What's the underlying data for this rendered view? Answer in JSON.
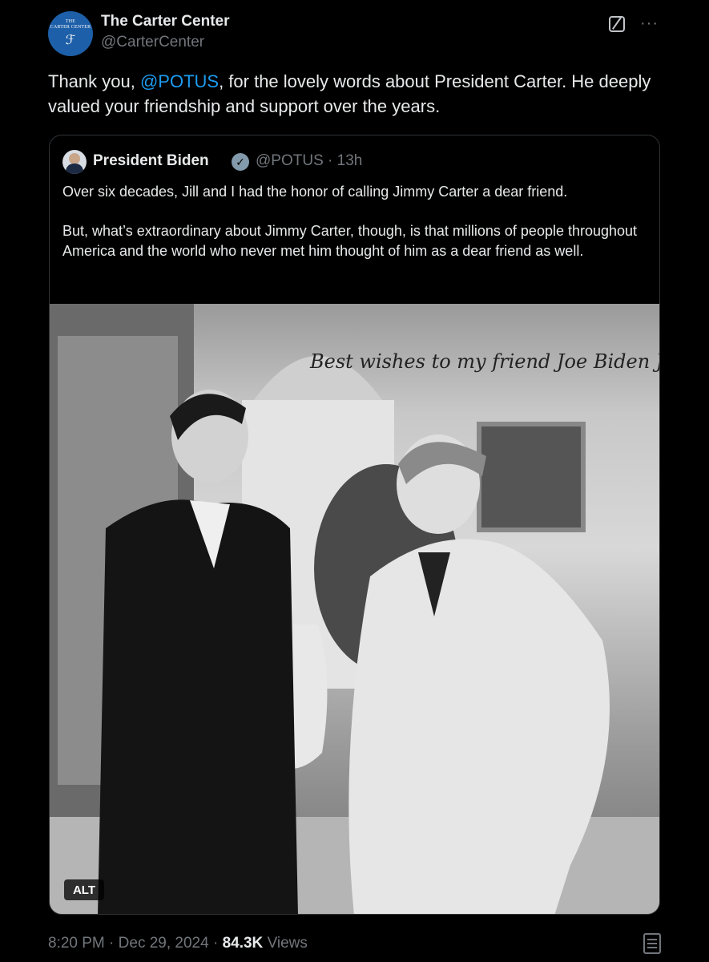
{
  "author": {
    "display_name": "The Carter Center",
    "handle": "@CarterCenter",
    "avatar_text": "THE CARTER CENTER",
    "avatar_color": "#1d5fa8"
  },
  "tweet": {
    "text_before": "Thank you, ",
    "mention": "@POTUS",
    "text_after": ", for the lovely words about President Carter. He deeply valued your friendship and support over the years."
  },
  "quote": {
    "display_name": "President Biden",
    "handle": "@POTUS",
    "separator": "·",
    "time": "13h",
    "paragraph_1": "Over six decades, Jill and I had the honor of calling Jimmy Carter a dear friend.",
    "paragraph_2": "But, what’s extraordinary about Jimmy Carter, though, is that millions of people throughout America and the world who never met him thought of him as a dear friend as well.",
    "alt_label": "ALT",
    "photo_inscription": "Best wishes to my friend Joe Biden Jimmy Carter"
  },
  "meta": {
    "time": "8:20 PM",
    "sep1": "·",
    "date": "Dec 29, 2024",
    "sep2": "·",
    "views_count": "84.3K",
    "views_label": "Views"
  },
  "colors": {
    "background": "#000000",
    "text": "#e7e9ea",
    "secondary": "#71767b",
    "accent": "#1d9bf0",
    "border": "#2f3336",
    "verified_badge": "#829aab"
  },
  "icons": {
    "grok": "grok-icon",
    "more": "more-icon",
    "verified": "verified-badge-icon",
    "bookmark": "bookmark-icon"
  }
}
